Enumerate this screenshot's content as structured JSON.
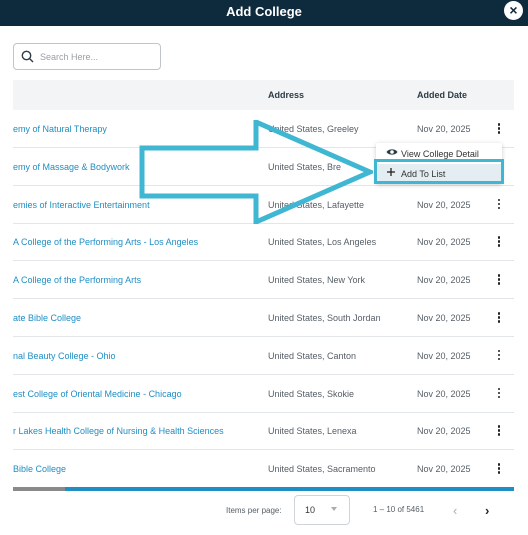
{
  "header": {
    "title": "Add College",
    "close_icon": "×"
  },
  "search": {
    "placeholder": "Search Here..."
  },
  "table": {
    "columns": {
      "name": "",
      "address": "Address",
      "added_date": "Added Date"
    },
    "rows": [
      {
        "name": "emy of Natural Therapy",
        "address": "United States, Greeley",
        "date": "Nov 20, 2025"
      },
      {
        "name": "emy of Massage & Bodywork",
        "address": "United States, Bre",
        "date": "Nov 20, 2025"
      },
      {
        "name": "emies of Interactive Entertainment",
        "address": "United States, Lafayette",
        "date": "Nov 20, 2025"
      },
      {
        "name": "A College of the Performing Arts - Los Angeles",
        "address": "United States, Los Angeles",
        "date": "Nov 20, 2025"
      },
      {
        "name": "A College of the Performing Arts",
        "address": "United States, New York",
        "date": "Nov 20, 2025"
      },
      {
        "name": "ate Bible College",
        "address": "United States, South Jordan",
        "date": "Nov 20, 2025"
      },
      {
        "name": "nal Beauty College - Ohio",
        "address": "United States, Canton",
        "date": "Nov 20, 2025"
      },
      {
        "name": "est College of Oriental Medicine - Chicago",
        "address": "United States, Skokie",
        "date": "Nov 20, 2025"
      },
      {
        "name": "r Lakes Health College of Nursing & Health Sciences",
        "address": "United States, Lenexa",
        "date": "Nov 20, 2025"
      },
      {
        "name": "Bible College",
        "address": "United States, Sacramento",
        "date": "Nov 20, 2025"
      }
    ]
  },
  "context_menu": {
    "items": [
      {
        "label": "View College Detail",
        "icon": "eye-icon"
      },
      {
        "label": "Add To List",
        "icon": "plus-icon"
      }
    ]
  },
  "pagination": {
    "items_per_page_label": "Items per page:",
    "items_per_page_value": "10",
    "range": "1 – 10 of 5461",
    "prev_icon": "‹",
    "next_icon": "›"
  },
  "colors": {
    "header_bg": "#0e2a3d",
    "link": "#1f8ec4",
    "highlight": "#3fb6d2"
  }
}
